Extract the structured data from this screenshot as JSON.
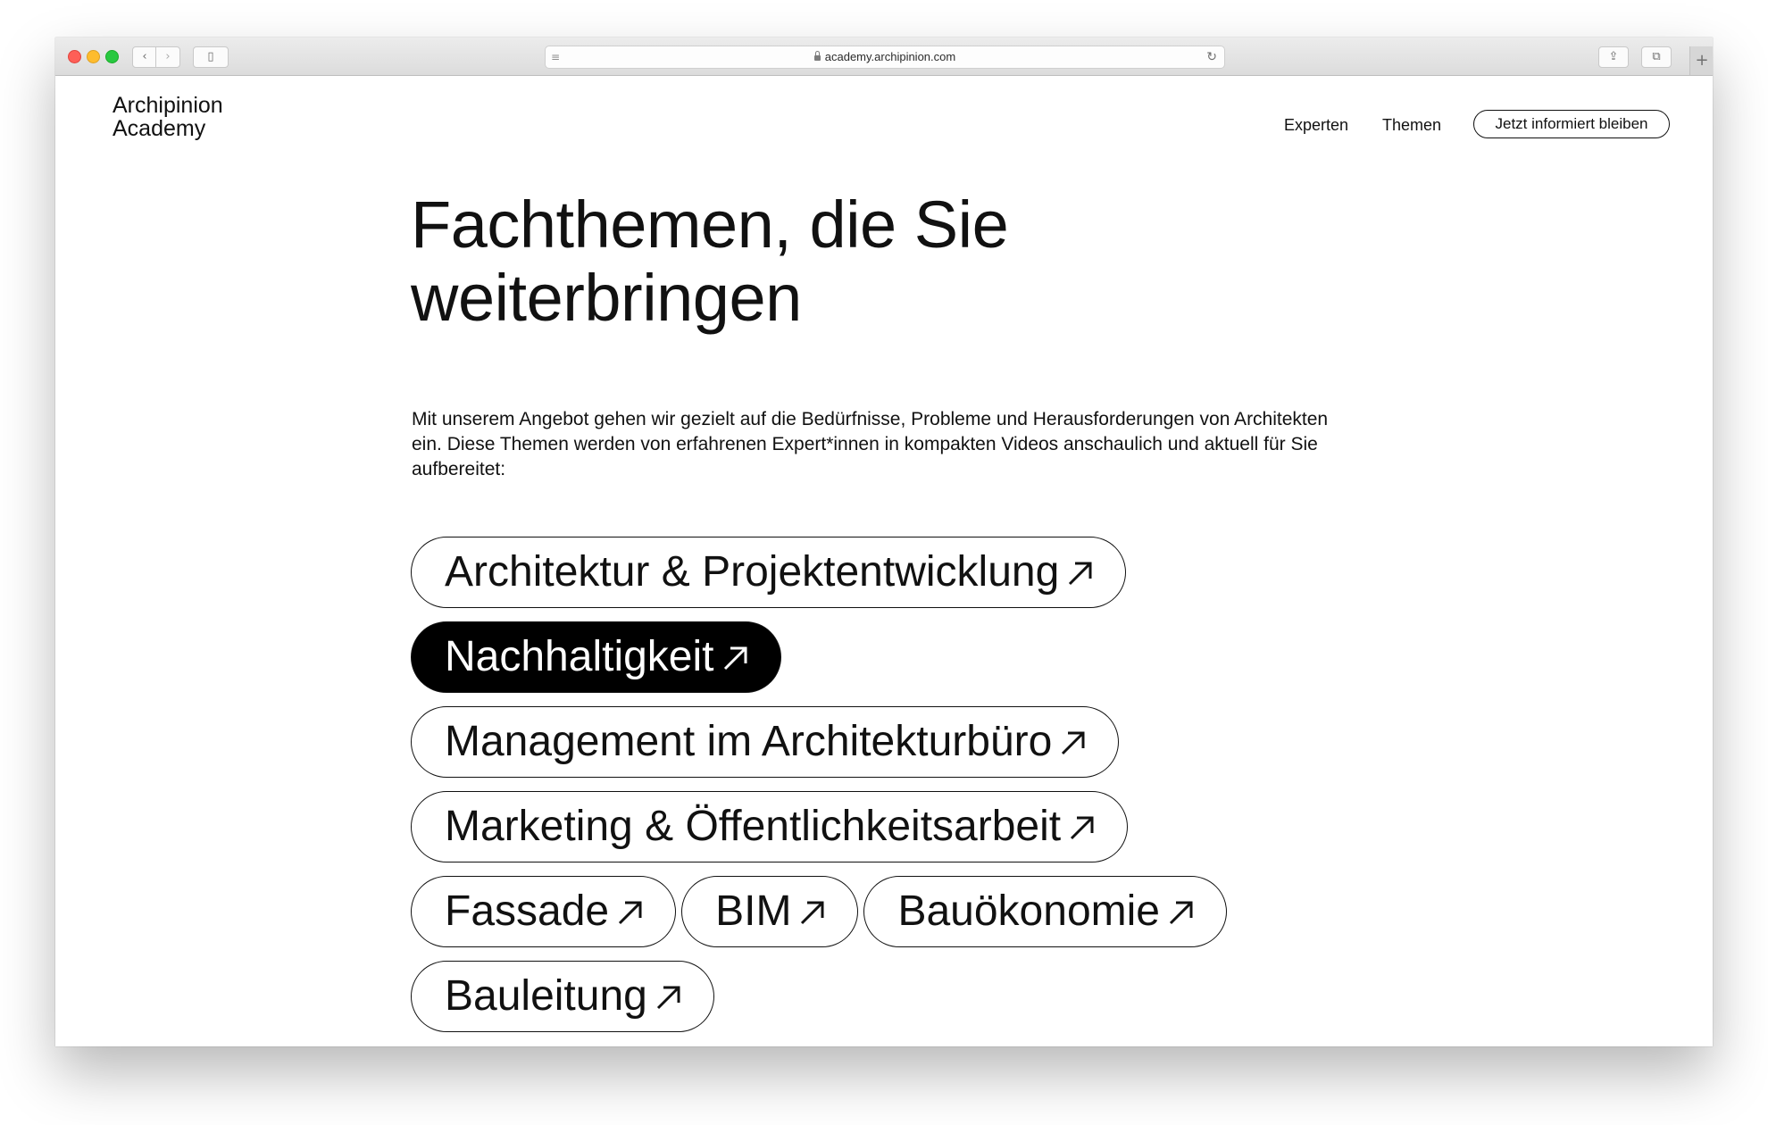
{
  "browser": {
    "url": "academy.archipinion.com",
    "back_glyph": "‹",
    "forward_glyph": "›",
    "sidebar_glyph": "▯",
    "reader_glyph": "≡",
    "reload_glyph": "↻",
    "share_glyph": "⇪",
    "tabs_glyph": "⧉",
    "newtab_glyph": "+"
  },
  "site": {
    "logo_line1": "Archipinion",
    "logo_line2": "Academy",
    "nav": {
      "experten": "Experten",
      "themen": "Themen",
      "cta": "Jetzt informiert bleiben"
    }
  },
  "main": {
    "headline": "Fachthemen, die Sie weiterbringen",
    "intro": "Mit unserem Angebot gehen wir gezielt auf die Bedürfnisse, Probleme und Herausforderungen von Architekten ein. Diese Themen werden von erfahrenen Expert*innen in kompakten Videos anschaulich und aktuell für Sie aufbereitet:",
    "topics": [
      {
        "label": "Architektur & Projektentwicklung",
        "active": false
      },
      {
        "label": "Nachhaltigkeit",
        "active": true
      },
      {
        "label": "Management im Architekturbüro",
        "active": false
      },
      {
        "label": "Marketing & Öffentlichkeitsarbeit",
        "active": false
      },
      {
        "label": "Fassade",
        "active": false
      },
      {
        "label": "BIM",
        "active": false
      },
      {
        "label": "Bauökonomie",
        "active": false
      },
      {
        "label": "Bauleitung",
        "active": false
      }
    ],
    "topic_icon": "arrow-up-right-icon"
  },
  "colors": {
    "text": "#111111",
    "active_bg": "#000000",
    "active_text": "#ffffff",
    "page_bg": "#ffffff"
  }
}
